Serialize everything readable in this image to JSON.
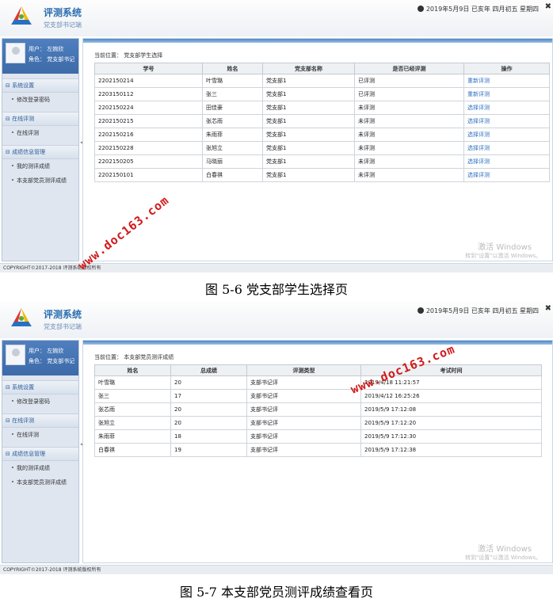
{
  "app": {
    "title": "评测系统",
    "subtitle": "党支部书记端",
    "date_text": "2019年5月9日 已亥年 四月初五 星期四",
    "close_glyph": "✖"
  },
  "user": {
    "name_line": "用户：   左婉欣",
    "role_line": "角色：  党支部书记"
  },
  "sidebar": [
    {
      "group": "⊟  系统设置",
      "items": [
        "修改登录密码"
      ]
    },
    {
      "group": "⊟  在线评测",
      "items": [
        "在线评测"
      ]
    },
    {
      "group": "⊟  成绩信息管理",
      "items": [
        "我的测评成绩",
        "本支部党员测评成绩"
      ]
    }
  ],
  "collapse_glyph": "◂",
  "screen1": {
    "breadcrumb": "当前位置：  党支部学生选择",
    "headers": [
      "学号",
      "姓名",
      "党支部名称",
      "是否已经评测",
      "操作"
    ],
    "rows": [
      [
        "2202150214",
        "叶雪璐",
        "党支部1",
        "已评测",
        "重新评测"
      ],
      [
        "2203150112",
        "张三",
        "党支部1",
        "已评测",
        "重新评测"
      ],
      [
        "2202150224",
        "田佳豪",
        "党支部1",
        "未评测",
        "选择评测"
      ],
      [
        "2202150215",
        "张芯雨",
        "党支部1",
        "未评测",
        "选择评测"
      ],
      [
        "2202150216",
        "朱雨菲",
        "党支部1",
        "未评测",
        "选择评测"
      ],
      [
        "2202150228",
        "张旭立",
        "党支部1",
        "未评测",
        "选择评测"
      ],
      [
        "2202150205",
        "马晓丽",
        "党支部1",
        "未评测",
        "选择评测"
      ],
      [
        "2202150101",
        "白春祺",
        "党支部1",
        "未评测",
        "选择评测"
      ]
    ],
    "caption": "图 5-6 党支部学生选择页"
  },
  "screen2": {
    "breadcrumb": "当前位置：  本支部党员测评成绩",
    "headers": [
      "姓名",
      "总成绩",
      "评测类型",
      "考试时间"
    ],
    "rows": [
      [
        "叶雪璐",
        "20",
        "支部书记评",
        "2019/4/18 11:21:57"
      ],
      [
        "张三",
        "17",
        "支部书记评",
        "2019/4/12 16:25:26"
      ],
      [
        "张芯雨",
        "20",
        "支部书记评",
        "2019/5/9 17:12:08"
      ],
      [
        "张旭立",
        "20",
        "支部书记评",
        "2019/5/9 17:12:20"
      ],
      [
        "朱雨菲",
        "18",
        "支部书记评",
        "2019/5/9 17:12:30"
      ],
      [
        "白春祺",
        "19",
        "支部书记评",
        "2019/5/9 17:12:38"
      ]
    ],
    "caption": "图 5-7 本支部党员测评成绩查看页"
  },
  "footer": "COPYRIGHT©2017-2018 评测系统版权所有",
  "windows_watermark": {
    "line1": "激活 Windows",
    "line2": "转到\"设置\"以激活 Windows。"
  },
  "site_watermark": "www.doc163.com",
  "colors": {
    "accent": "#2a6eb0",
    "link": "#2d6fc0",
    "watermark": "#d21a1a"
  }
}
